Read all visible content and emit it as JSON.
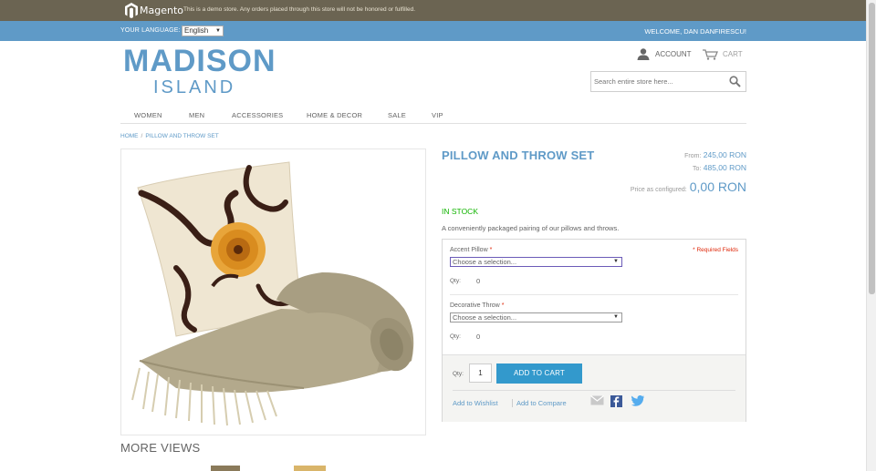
{
  "demo_bar": {
    "logo_text": "Magento",
    "notice": "This is a demo store. Any orders placed through this store will not be honored or fulfilled."
  },
  "header": {
    "language_label": "YOUR LANGUAGE:",
    "language_value": "English",
    "welcome": "WELCOME, DAN DANFIRESCU!",
    "account_label": "ACCOUNT",
    "cart_label": "CART"
  },
  "logo": {
    "main": "MADISON",
    "sub": "ISLAND"
  },
  "search": {
    "placeholder": "Search entire store here..."
  },
  "nav": {
    "items": [
      "WOMEN",
      "MEN",
      "ACCESSORIES",
      "HOME & DECOR",
      "SALE",
      "VIP"
    ]
  },
  "breadcrumb": {
    "home": "HOME",
    "separator": "/",
    "current": "PILLOW AND THROW SET"
  },
  "product": {
    "name": "PILLOW AND THROW SET",
    "price_from_label": "From:",
    "price_from": "245,00 RON",
    "price_to_label": "To:",
    "price_to": "485,00 RON",
    "price_configured_label": "Price as configured:",
    "price_configured": "0,00 RON",
    "stock": "IN STOCK",
    "description": "A conveniently packaged pairing of our pillows and throws.",
    "more_views": "MORE VIEWS"
  },
  "options": {
    "required_note": "* Required Fields",
    "items": [
      {
        "label": "Accent Pillow",
        "required": "*",
        "select_value": "Choose a selection...",
        "qty_label": "Qty:",
        "qty_value": "0"
      },
      {
        "label": "Decorative Throw",
        "required": "*",
        "select_value": "Choose a selection...",
        "qty_label": "Qty:",
        "qty_value": "0"
      }
    ]
  },
  "add_to_cart": {
    "qty_label": "Qty:",
    "qty_value": "1",
    "button": "ADD TO CART",
    "wishlist": "Add to Wishlist",
    "compare": "Add to Compare"
  },
  "colors": {
    "brand_blue": "#5f9ac7",
    "button_blue": "#3399cc",
    "stock_green": "#11b400",
    "demo_bar": "#6b6452"
  },
  "icons": [
    "magento-logo-icon",
    "account-icon",
    "cart-icon",
    "search-icon",
    "email-icon",
    "facebook-icon",
    "twitter-icon"
  ]
}
